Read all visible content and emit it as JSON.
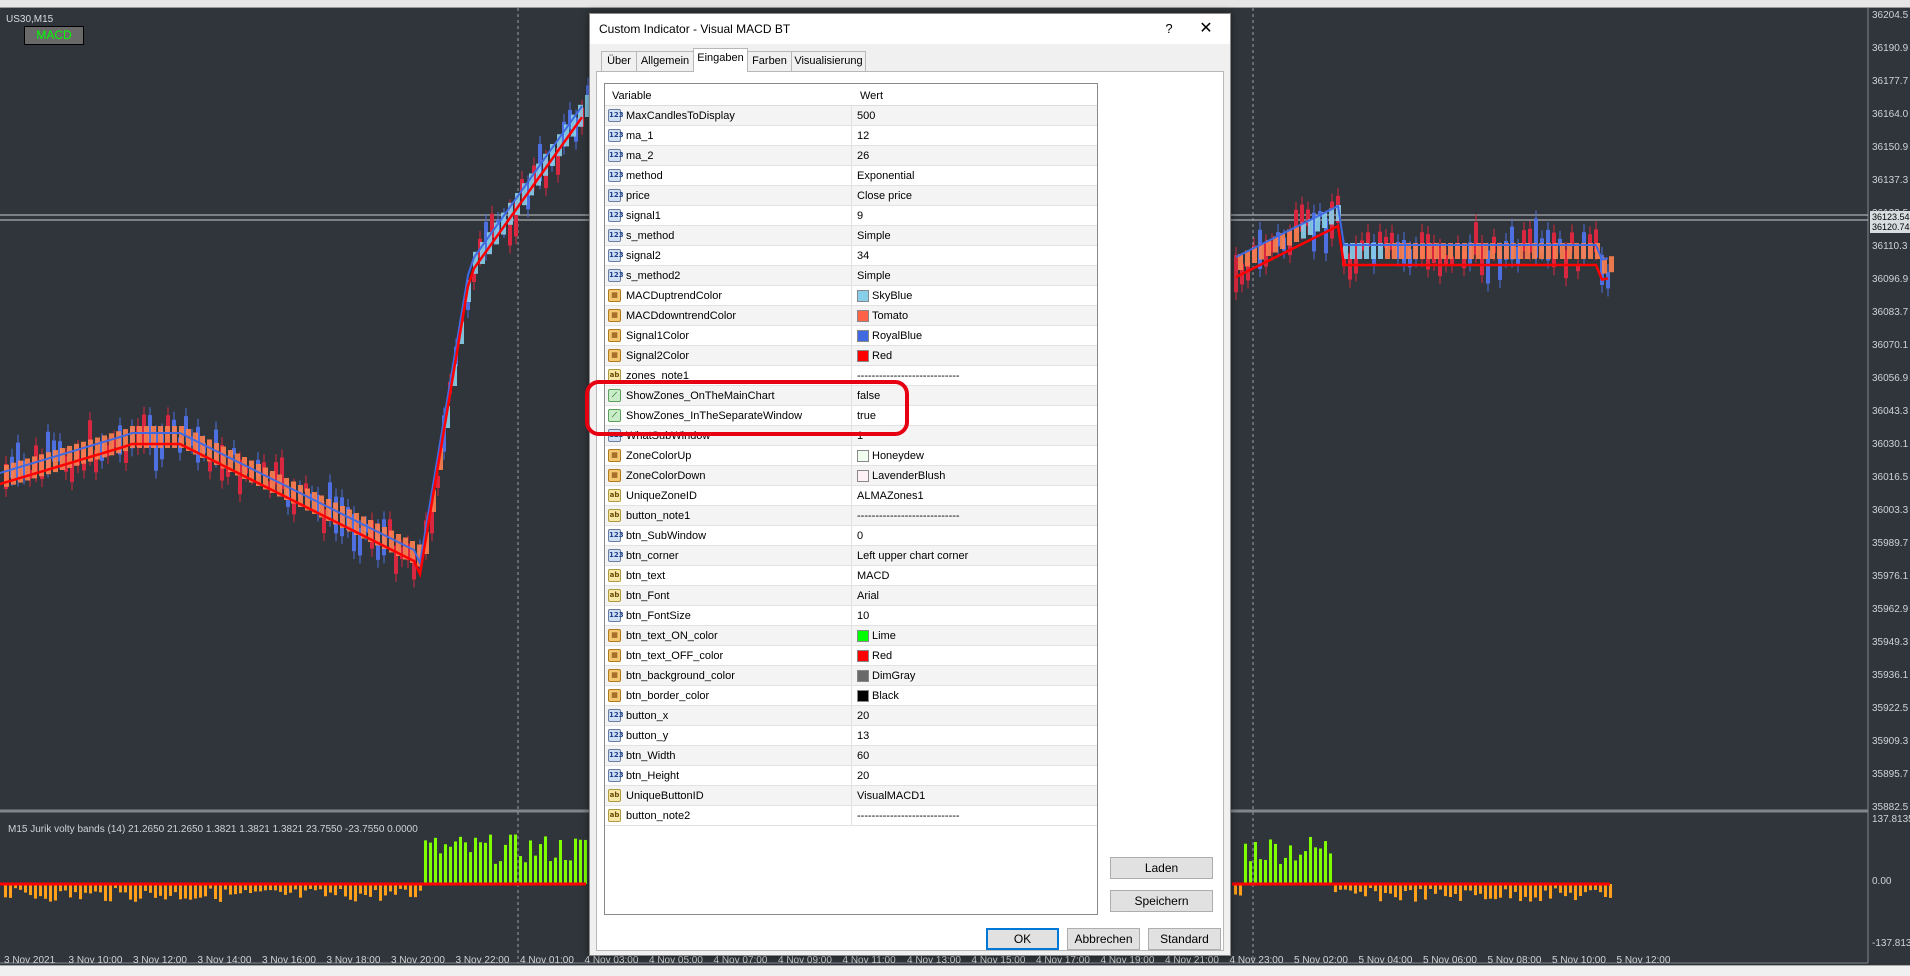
{
  "chart": {
    "symbol": "US30,M15",
    "button_label": "MACD",
    "subwindow_label": "M15 Jurik volty bands (14) 21.2650 21.2650 1.3821 1.3821 1.3821 23.7550 -23.7550 0.0000",
    "price_labels": [
      "36204.5",
      "36190.9",
      "36177.7",
      "36164.0",
      "36150.9",
      "36137.3",
      "36123.5",
      "36110.3",
      "36096.9",
      "36083.7",
      "36070.1",
      "36056.9",
      "36043.3",
      "36030.1",
      "36016.5",
      "36003.3",
      "35989.7",
      "35976.1",
      "35962.9",
      "35949.3",
      "35936.1",
      "35922.5",
      "35909.3",
      "35895.7",
      "35882.5"
    ],
    "price_tags": [
      "36123.54",
      "36120.74"
    ],
    "sub_labels": [
      "137.8135",
      "0.00",
      "-137.8135"
    ],
    "time_labels": [
      "3 Nov 2021",
      "3 Nov 10:00",
      "3 Nov 12:00",
      "3 Nov 14:00",
      "3 Nov 16:00",
      "3 Nov 18:00",
      "3 Nov 20:00",
      "3 Nov 22:00",
      "4 Nov 01:00",
      "4 Nov 03:00",
      "4 Nov 05:00",
      "4 Nov 07:00",
      "4 Nov 09:00",
      "4 Nov 11:00",
      "4 Nov 13:00",
      "4 Nov 15:00",
      "4 Nov 17:00",
      "4 Nov 19:00",
      "4 Nov 21:00",
      "4 Nov 23:00",
      "5 Nov 02:00",
      "5 Nov 04:00",
      "5 Nov 06:00",
      "5 Nov 08:00",
      "5 Nov 10:00",
      "5 Nov 12:00"
    ]
  },
  "dialog": {
    "title": "Custom Indicator - Visual MACD BT",
    "help": "?",
    "close": "✕",
    "tabs": [
      "Über",
      "Allgemein",
      "Eingaben",
      "Farben",
      "Visualisierung"
    ],
    "active_tab": "Eingaben",
    "headers": {
      "variable": "Variable",
      "value": "Wert"
    },
    "rows": [
      {
        "type": "num",
        "name": "MaxCandlesToDisplay",
        "value": "500"
      },
      {
        "type": "num",
        "name": "ma_1",
        "value": "12"
      },
      {
        "type": "num",
        "name": "ma_2",
        "value": "26"
      },
      {
        "type": "num",
        "name": "method",
        "value": "Exponential"
      },
      {
        "type": "num",
        "name": "price",
        "value": "Close price"
      },
      {
        "type": "num",
        "name": "signal1",
        "value": "9"
      },
      {
        "type": "num",
        "name": "s_method",
        "value": "Simple"
      },
      {
        "type": "num",
        "name": "signal2",
        "value": "34"
      },
      {
        "type": "num",
        "name": "s_method2",
        "value": "Simple"
      },
      {
        "type": "clr",
        "name": "MACDuptrendColor",
        "value": "SkyBlue",
        "swatch": "#87ceeb"
      },
      {
        "type": "clr",
        "name": "MACDdowntrendColor",
        "value": "Tomato",
        "swatch": "#ff6347"
      },
      {
        "type": "clr",
        "name": "Signal1Color",
        "value": "RoyalBlue",
        "swatch": "#4169e1"
      },
      {
        "type": "clr",
        "name": "Signal2Color",
        "value": "Red",
        "swatch": "#ff0000"
      },
      {
        "type": "str",
        "name": "zones_note1",
        "value": "----------------------------"
      },
      {
        "type": "bool",
        "name": "ShowZones_OnTheMainChart",
        "value": "false"
      },
      {
        "type": "bool",
        "name": "ShowZones_InTheSeparateWindow",
        "value": "true"
      },
      {
        "type": "num",
        "name": "WhatSubWindow",
        "value": "1"
      },
      {
        "type": "clr",
        "name": "ZoneColorUp",
        "value": "Honeydew",
        "swatch": "#f0fff0"
      },
      {
        "type": "clr",
        "name": "ZoneColorDown",
        "value": "LavenderBlush",
        "swatch": "#fff0f5"
      },
      {
        "type": "str",
        "name": "UniqueZoneID",
        "value": "ALMAZones1"
      },
      {
        "type": "str",
        "name": "button_note1",
        "value": "----------------------------"
      },
      {
        "type": "num",
        "name": "btn_SubWindow",
        "value": "0"
      },
      {
        "type": "num",
        "name": "btn_corner",
        "value": "Left upper chart corner"
      },
      {
        "type": "str",
        "name": "btn_text",
        "value": "MACD"
      },
      {
        "type": "str",
        "name": "btn_Font",
        "value": "Arial"
      },
      {
        "type": "num",
        "name": "btn_FontSize",
        "value": "10"
      },
      {
        "type": "clr",
        "name": "btn_text_ON_color",
        "value": "Lime",
        "swatch": "#00ff00"
      },
      {
        "type": "clr",
        "name": "btn_text_OFF_color",
        "value": "Red",
        "swatch": "#ff0000"
      },
      {
        "type": "clr",
        "name": "btn_background_color",
        "value": "DimGray",
        "swatch": "#696969"
      },
      {
        "type": "clr",
        "name": "btn_border_color",
        "value": "Black",
        "swatch": "#000000"
      },
      {
        "type": "num",
        "name": "button_x",
        "value": "20"
      },
      {
        "type": "num",
        "name": "button_y",
        "value": "13"
      },
      {
        "type": "num",
        "name": "btn_Width",
        "value": "60"
      },
      {
        "type": "num",
        "name": "btn_Height",
        "value": "20"
      },
      {
        "type": "str",
        "name": "UniqueButtonID",
        "value": "VisualMACD1"
      },
      {
        "type": "str",
        "name": "button_note2",
        "value": "----------------------------"
      }
    ],
    "type_icon_labels": {
      "num": "123",
      "str": "ab",
      "clr": "▦",
      "bool": "⟋"
    },
    "side_buttons": {
      "load": "Laden",
      "save": "Speichern"
    },
    "footer_buttons": {
      "ok": "OK",
      "cancel": "Abbrechen",
      "default": "Standard"
    }
  }
}
